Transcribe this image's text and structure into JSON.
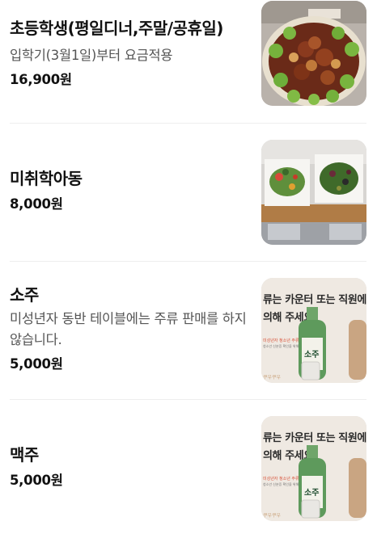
{
  "items": [
    {
      "name": "초등학생(평일디너,주말/공휴일)",
      "desc": "입학기(3월1일)부터 요금적용",
      "price": "16,900원",
      "image": "braised-chicken-dish"
    },
    {
      "name": "미취학아동",
      "desc": "",
      "price": "8,000원",
      "image": "buffet-salad-trays"
    },
    {
      "name": "소주",
      "desc": "미성년자 동반 테이블에는 주류 판매를 하지 않습니다.",
      "price": "5,000원",
      "image": "soju-poster"
    },
    {
      "name": "맥주",
      "desc": "",
      "price": "5,000원",
      "image": "soju-poster"
    }
  ],
  "poster": {
    "line1": "류는 카운터 또는 직원에",
    "line2": "의해 주세요",
    "notice_title": "미성년자 청소년 주류판매금지",
    "notice_sub": "청소년 신분증 확인을 위해 협조 부탁드립니다",
    "brand": "쿠우쿠우",
    "bottle_label": "소주"
  },
  "colors": {
    "text": "#111111",
    "desc": "#555555",
    "divider": "#eeeeee"
  }
}
